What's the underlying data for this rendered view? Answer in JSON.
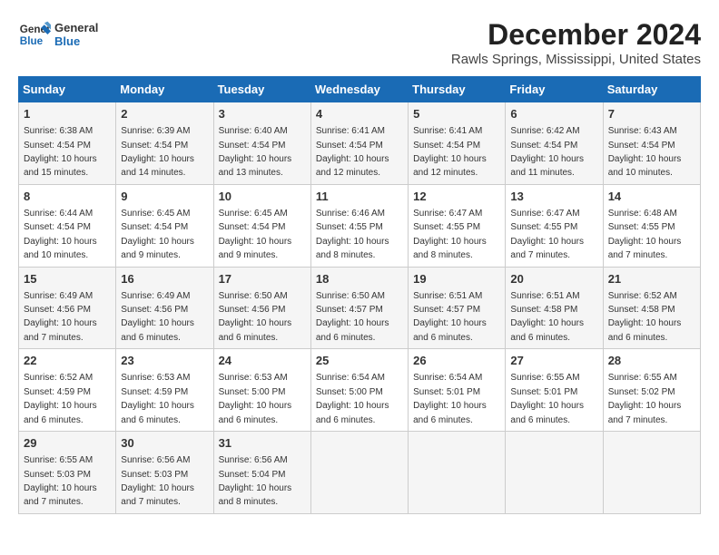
{
  "logo": {
    "line1": "General",
    "line2": "Blue"
  },
  "title": "December 2024",
  "location": "Rawls Springs, Mississippi, United States",
  "weekdays": [
    "Sunday",
    "Monday",
    "Tuesday",
    "Wednesday",
    "Thursday",
    "Friday",
    "Saturday"
  ],
  "weeks": [
    [
      {
        "day": "1",
        "sunrise": "6:38 AM",
        "sunset": "4:54 PM",
        "daylight": "10 hours and 15 minutes."
      },
      {
        "day": "2",
        "sunrise": "6:39 AM",
        "sunset": "4:54 PM",
        "daylight": "10 hours and 14 minutes."
      },
      {
        "day": "3",
        "sunrise": "6:40 AM",
        "sunset": "4:54 PM",
        "daylight": "10 hours and 13 minutes."
      },
      {
        "day": "4",
        "sunrise": "6:41 AM",
        "sunset": "4:54 PM",
        "daylight": "10 hours and 12 minutes."
      },
      {
        "day": "5",
        "sunrise": "6:41 AM",
        "sunset": "4:54 PM",
        "daylight": "10 hours and 12 minutes."
      },
      {
        "day": "6",
        "sunrise": "6:42 AM",
        "sunset": "4:54 PM",
        "daylight": "10 hours and 11 minutes."
      },
      {
        "day": "7",
        "sunrise": "6:43 AM",
        "sunset": "4:54 PM",
        "daylight": "10 hours and 10 minutes."
      }
    ],
    [
      {
        "day": "8",
        "sunrise": "6:44 AM",
        "sunset": "4:54 PM",
        "daylight": "10 hours and 10 minutes."
      },
      {
        "day": "9",
        "sunrise": "6:45 AM",
        "sunset": "4:54 PM",
        "daylight": "10 hours and 9 minutes."
      },
      {
        "day": "10",
        "sunrise": "6:45 AM",
        "sunset": "4:54 PM",
        "daylight": "10 hours and 9 minutes."
      },
      {
        "day": "11",
        "sunrise": "6:46 AM",
        "sunset": "4:55 PM",
        "daylight": "10 hours and 8 minutes."
      },
      {
        "day": "12",
        "sunrise": "6:47 AM",
        "sunset": "4:55 PM",
        "daylight": "10 hours and 8 minutes."
      },
      {
        "day": "13",
        "sunrise": "6:47 AM",
        "sunset": "4:55 PM",
        "daylight": "10 hours and 7 minutes."
      },
      {
        "day": "14",
        "sunrise": "6:48 AM",
        "sunset": "4:55 PM",
        "daylight": "10 hours and 7 minutes."
      }
    ],
    [
      {
        "day": "15",
        "sunrise": "6:49 AM",
        "sunset": "4:56 PM",
        "daylight": "10 hours and 7 minutes."
      },
      {
        "day": "16",
        "sunrise": "6:49 AM",
        "sunset": "4:56 PM",
        "daylight": "10 hours and 6 minutes."
      },
      {
        "day": "17",
        "sunrise": "6:50 AM",
        "sunset": "4:56 PM",
        "daylight": "10 hours and 6 minutes."
      },
      {
        "day": "18",
        "sunrise": "6:50 AM",
        "sunset": "4:57 PM",
        "daylight": "10 hours and 6 minutes."
      },
      {
        "day": "19",
        "sunrise": "6:51 AM",
        "sunset": "4:57 PM",
        "daylight": "10 hours and 6 minutes."
      },
      {
        "day": "20",
        "sunrise": "6:51 AM",
        "sunset": "4:58 PM",
        "daylight": "10 hours and 6 minutes."
      },
      {
        "day": "21",
        "sunrise": "6:52 AM",
        "sunset": "4:58 PM",
        "daylight": "10 hours and 6 minutes."
      }
    ],
    [
      {
        "day": "22",
        "sunrise": "6:52 AM",
        "sunset": "4:59 PM",
        "daylight": "10 hours and 6 minutes."
      },
      {
        "day": "23",
        "sunrise": "6:53 AM",
        "sunset": "4:59 PM",
        "daylight": "10 hours and 6 minutes."
      },
      {
        "day": "24",
        "sunrise": "6:53 AM",
        "sunset": "5:00 PM",
        "daylight": "10 hours and 6 minutes."
      },
      {
        "day": "25",
        "sunrise": "6:54 AM",
        "sunset": "5:00 PM",
        "daylight": "10 hours and 6 minutes."
      },
      {
        "day": "26",
        "sunrise": "6:54 AM",
        "sunset": "5:01 PM",
        "daylight": "10 hours and 6 minutes."
      },
      {
        "day": "27",
        "sunrise": "6:55 AM",
        "sunset": "5:01 PM",
        "daylight": "10 hours and 6 minutes."
      },
      {
        "day": "28",
        "sunrise": "6:55 AM",
        "sunset": "5:02 PM",
        "daylight": "10 hours and 7 minutes."
      }
    ],
    [
      {
        "day": "29",
        "sunrise": "6:55 AM",
        "sunset": "5:03 PM",
        "daylight": "10 hours and 7 minutes."
      },
      {
        "day": "30",
        "sunrise": "6:56 AM",
        "sunset": "5:03 PM",
        "daylight": "10 hours and 7 minutes."
      },
      {
        "day": "31",
        "sunrise": "6:56 AM",
        "sunset": "5:04 PM",
        "daylight": "10 hours and 8 minutes."
      },
      null,
      null,
      null,
      null
    ]
  ],
  "labels": {
    "sunrise": "Sunrise: ",
    "sunset": "Sunset: ",
    "daylight": "Daylight: "
  }
}
